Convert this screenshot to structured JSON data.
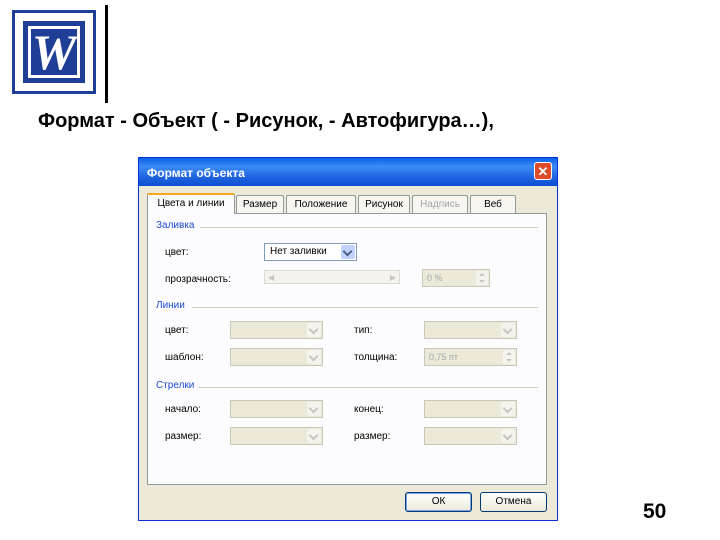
{
  "slide": {
    "logo_letter": "W",
    "heading": "Формат - Объект ( - Рисунок, - Автофигура…),",
    "page_number": "50"
  },
  "dialog": {
    "title": "Формат объекта",
    "close_glyph": "✕",
    "tabs": [
      {
        "label": "Цвета и линии",
        "active": true,
        "disabled": false
      },
      {
        "label": "Размер",
        "active": false,
        "disabled": false
      },
      {
        "label": "Положение",
        "active": false,
        "disabled": false
      },
      {
        "label": "Рисунок",
        "active": false,
        "disabled": false
      },
      {
        "label": "Надпись",
        "active": false,
        "disabled": true
      },
      {
        "label": "Веб",
        "active": false,
        "disabled": false
      }
    ],
    "fill": {
      "group_label": "Заливка",
      "color_label": "цвет:",
      "color_value": "Нет заливки",
      "transparency_label": "прозрачность:",
      "transparency_value": "0 %"
    },
    "lines": {
      "group_label": "Линии",
      "color_label": "цвет:",
      "type_label": "тип:",
      "pattern_label": "шаблон:",
      "weight_label": "толщина:",
      "weight_value": "0,75 пт"
    },
    "arrows": {
      "group_label": "Стрелки",
      "start_label": "начало:",
      "end_label": "конец:",
      "start_size_label": "размер:",
      "end_size_label": "размер:"
    },
    "buttons": {
      "ok": "ОК",
      "cancel": "Отмена"
    }
  },
  "colors": {
    "titlebar": "#0a5fe6",
    "dialog_bg": "#ece9d8",
    "group_label": "#1c4cd2",
    "active_tab_accent": "#f5a623"
  }
}
